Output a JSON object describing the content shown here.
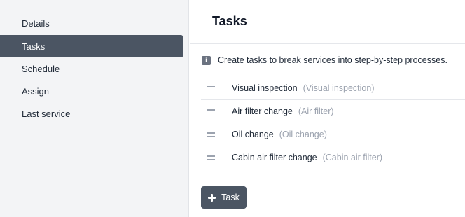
{
  "sidebar": {
    "items": [
      {
        "label": "Details",
        "active": false
      },
      {
        "label": "Tasks",
        "active": true
      },
      {
        "label": "Schedule",
        "active": false
      },
      {
        "label": "Assign",
        "active": false
      },
      {
        "label": "Last service",
        "active": false
      }
    ]
  },
  "main": {
    "title": "Tasks",
    "info_text": "Create tasks to break services into step-by-step processes.",
    "info_icon": "info-icon",
    "tasks": [
      {
        "name": "Visual inspection",
        "type": "(Visual inspection)"
      },
      {
        "name": "Air filter change",
        "type": "(Air filter)"
      },
      {
        "name": "Oil change",
        "type": "(Oil change)"
      },
      {
        "name": "Cabin air filter change",
        "type": "(Cabin air filter)"
      }
    ],
    "add_button_label": "Task"
  },
  "colors": {
    "sidebar_bg": "#f3f4f6",
    "active_bg": "#4b5563",
    "button_bg": "#4b5563",
    "muted_text": "#9ca3af"
  }
}
